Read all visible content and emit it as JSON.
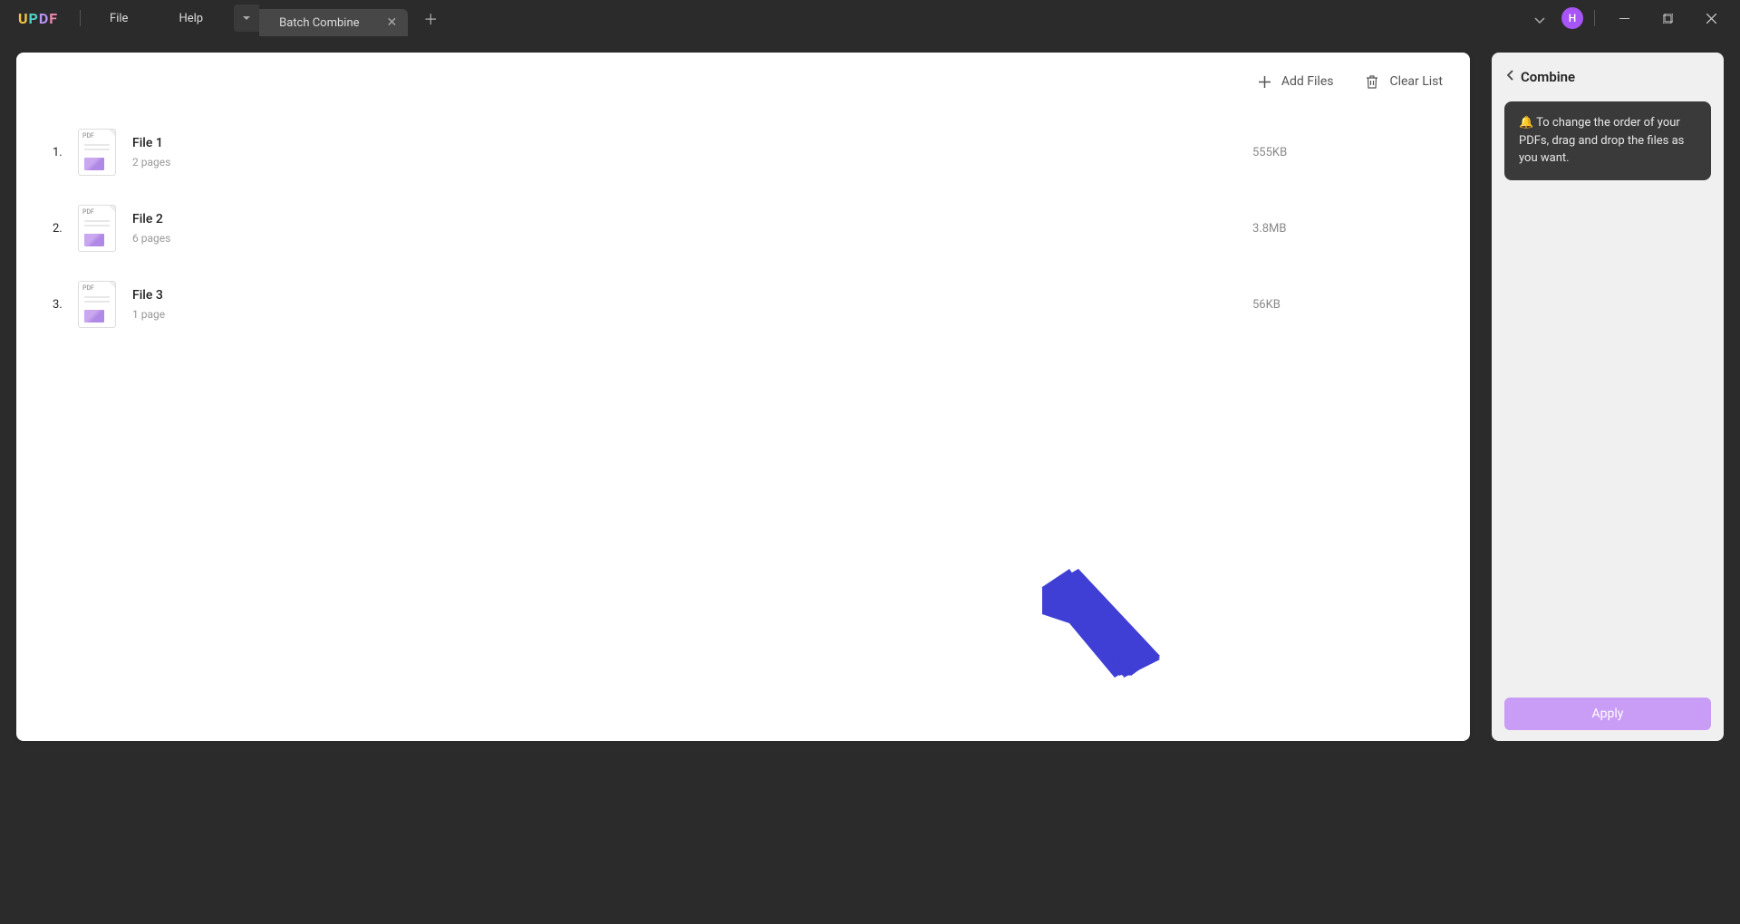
{
  "titlebar": {
    "menu_file": "File",
    "menu_help": "Help",
    "tab_label": "Batch Combine",
    "avatar_letter": "H"
  },
  "toolbar": {
    "add_files": "Add Files",
    "clear_list": "Clear List"
  },
  "files": [
    {
      "index": "1.",
      "name": "File 1",
      "pages": "2 pages",
      "size": "555KB"
    },
    {
      "index": "2.",
      "name": "File 2",
      "pages": "6 pages",
      "size": "3.8MB"
    },
    {
      "index": "3.",
      "name": "File 3",
      "pages": "1 page",
      "size": "56KB"
    }
  ],
  "sidebar": {
    "title": "Combine",
    "hint": "🔔 To change the order of your PDFs, drag and drop the files as you want.",
    "apply": "Apply"
  }
}
